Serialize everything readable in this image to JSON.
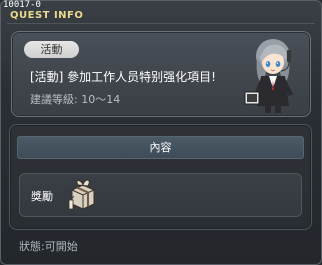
{
  "header": {
    "quest_id": "10017-0",
    "window_title": "QUEST INFO"
  },
  "quest": {
    "badge": "活動",
    "title": "[活動] 參加工作人员特别强化項目!",
    "level_label": "建議等級",
    "level_range": "10～14"
  },
  "content": {
    "section_title": "內容",
    "reward_label": "獎勵"
  },
  "footer": {
    "status_label": "狀態",
    "status_value": "可開始"
  },
  "colors": {
    "title_gold": "#e9d98a",
    "window_bg": "#2b2f35",
    "content_bar": "#43535e"
  },
  "icons": {
    "npc": "npc-staff-character",
    "reward": "reward-box-item"
  }
}
